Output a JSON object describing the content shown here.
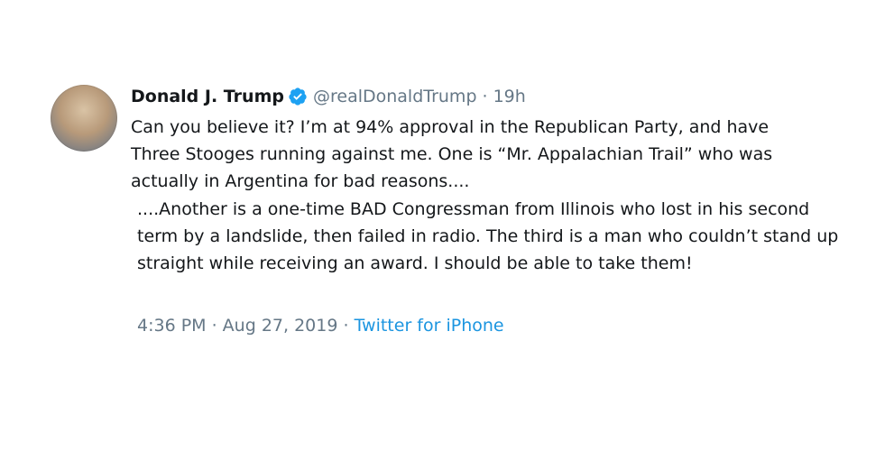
{
  "tweet": {
    "author_name": "Donald J. Trump",
    "handle": "@realDonaldTrump",
    "separator": "·",
    "relative_time": "19h",
    "text_part1": "Can you believe it? I’m at 94% approval in the Republican Party, and have Three Stooges running against me. One is “Mr. Appalachian Trail” who was actually in Argentina for bad reasons....",
    "text_part2": "....Another is a one-time BAD Congressman from Illinois who lost in his second term by a landslide, then failed in radio. The third is a man who couldn’t stand up straight while receiving an award. I should be able to take them!",
    "timestamp": "4:36 PM · Aug 27, 2019",
    "footer_separator": "·",
    "source": "Twitter for iPhone",
    "verified_icon": "verified-badge-icon",
    "colors": {
      "text": "#14171a",
      "secondary": "#657786",
      "link": "#1b95e0",
      "verified": "#1da1f2"
    }
  }
}
